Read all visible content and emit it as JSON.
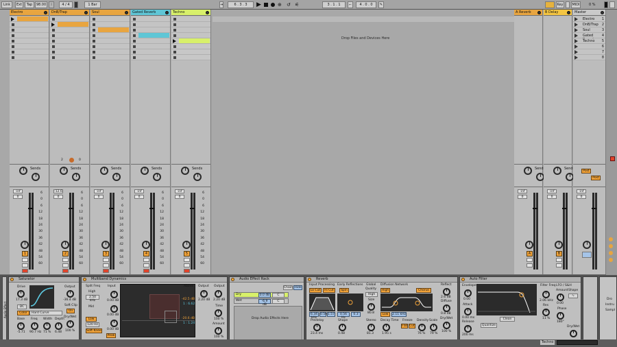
{
  "topbar": {
    "link": "Link",
    "ext": "Ext",
    "tap": "Tap",
    "tempo": "98.00",
    "time_sig": "4 / 4",
    "quantize": "1 Bar",
    "position": "6 . 3 . 3",
    "loop_start": "3 . 1 . 1",
    "loop_length": "4 . 0 . 0",
    "key": "Key",
    "midi": "MIDI",
    "cpu": "0 %"
  },
  "colors": {
    "orange": "#e8a540",
    "blue": "#5fc6d6",
    "lime": "#d8f06a",
    "yellow": "#f4c542"
  },
  "tracks": [
    {
      "name": "Electro",
      "number": "1",
      "vol": "-inf",
      "pan": "0"
    },
    {
      "name": "DnB/Trap",
      "number": "2",
      "vol": "-12.6",
      "pan": "0"
    },
    {
      "name": "Soul",
      "number": "3",
      "vol": "-inf",
      "pan": "0"
    },
    {
      "name": "Gated Reverb",
      "number": "4",
      "vol": "-inf",
      "pan": "0"
    },
    {
      "name": "Techno",
      "number": "5",
      "vol": "-inf",
      "pan": "0"
    }
  ],
  "returns": [
    {
      "name": "A Reverb",
      "letter": "A",
      "vol": "-inf",
      "pan": "0"
    },
    {
      "name": "B Delay",
      "letter": "B",
      "vol": "-inf",
      "pan": "0"
    }
  ],
  "master": {
    "name": "Master",
    "vol": "-inf",
    "pan": "0",
    "scenes": [
      "Electro",
      "DnB/Trap",
      "Soul",
      "Gated Reverb",
      "Techno",
      "",
      "",
      ""
    ],
    "scene_numbers": [
      "1",
      "2",
      "3",
      "4",
      "5",
      "6",
      "7",
      "8"
    ],
    "post1": "Post",
    "post2": "Post"
  },
  "sends_label": "Sends",
  "drop_files": "Drop Files and Devices Here",
  "scale_marks": [
    "6",
    "0",
    "6",
    "12",
    "18",
    "24",
    "30",
    "36",
    "42",
    "48",
    "54",
    "60"
  ],
  "clip_count_dnb": [
    "2",
    "0"
  ],
  "devices": {
    "saturator": {
      "title": "Saturator",
      "drive": "Drive",
      "drive_val": "17.3 dB",
      "dc": "DC",
      "color": "Color",
      "curve": "Hard Curve",
      "output": "Output",
      "output_val": "-36.4 dB",
      "soft_clip": "Soft Clip",
      "soft_on": "On",
      "drywet": "Dry/Wet",
      "drywet_val": "100 %",
      "base": "Base",
      "base_val": "-5.71",
      "freq": "Freq",
      "freq_val": "90.7 Hz",
      "width": "Width",
      "width_val": "71 %",
      "depth": "Depth",
      "depth_val": "6.48"
    },
    "multiband": {
      "title": "Multiband Dynamics",
      "split": "Split Freq",
      "high": "High",
      "high_freq": "2.50 kHz",
      "mid": "Mid",
      "low": "Low",
      "low_freq": "120 Hz",
      "input": "Input",
      "in1": "0.00 dB",
      "in2": "0.00 dB",
      "in3": "0.00 dB",
      "soft_knee": "Soft Knee",
      "peak": "Peak",
      "above": "Above",
      "below": "Below",
      "v1": "-42.5 dB",
      "v2": "1 : 6.62",
      "v3": "-20.6 dB",
      "v4": "1 : 1.24",
      "output": "Output",
      "out_val": "2.20 dB",
      "time": "Time",
      "time_val": "100 %",
      "amount": "Amount",
      "amount_val": "100 %"
    },
    "rack": {
      "title": "Audio Effect Rack",
      "chain": "Chain",
      "hide": "Hide",
      "dry": "Dry",
      "wet": "Wet",
      "dry_vol": "0.0 dB",
      "wet_vol": "-6.9 dB",
      "pan": "C",
      "drop": "Drop Audio Effects Here"
    },
    "reverb": {
      "title": "Reverb",
      "input": "Input Processing",
      "lo_cut": "Lo Cut",
      "hi_cut": "Hi Cut",
      "early": "Early Reflections",
      "spin": "Spin",
      "global": "Global",
      "quality": "Quality",
      "quality_val": "High",
      "size": "Size",
      "size_val": "80.8",
      "diffusion": "Diffusion Network",
      "high": "High",
      "high_val": "2.11 kHz",
      "low": "Low",
      "chorus": "Chorus",
      "reflect": "Reflect",
      "reflect_val": "2.6 dB",
      "diffuse": "Diffuse",
      "diffuse_val": "0.8 dB",
      "drywet": "Dry/Wet",
      "drywet_val": "100 %",
      "predelay": "Predelay",
      "predelay_val": "23.4 ms",
      "shape": "Shape",
      "shape_val": "0.48",
      "stereo": "Stereo",
      "stereo_val": "81.3",
      "decay": "Decay Time",
      "decay_val": "1.95 s",
      "freeze": "Freeze",
      "flat": "Flat",
      "cut": "Cut",
      "density": "Density",
      "density_val": "76 %",
      "scale": "Scale",
      "scale_val": "79 %",
      "inp1": "6.34 kHz",
      "inp2": "0.50",
      "inp3": "1.57",
      "er1": "0.56 Hz",
      "er2": "0.3"
    },
    "autofilter": {
      "title": "Auto Filter",
      "envelope": "Envelope",
      "env_val": "0.00",
      "attack": "Attack",
      "attack_val": "0.00 ms",
      "release": "Release",
      "release_val": "200 ms",
      "filter_freq": "Filter Freq",
      "freq_val": "2.06 kHz",
      "res": "Res",
      "res_val": "11 %",
      "lfo": "LFO / S&H",
      "amount": "Amount",
      "amount_val": "0.00",
      "shape": "Shape",
      "phase": "Phase",
      "phase_val": "180°",
      "quantize": "Quantize",
      "clean": "Clean",
      "drywet": "Dry/Wet"
    },
    "right_panel": {
      "line1": "Dro",
      "line2": "Instru",
      "line3": "Sampl"
    },
    "track_label": "Techno"
  },
  "side_tab": "Audio Effect"
}
